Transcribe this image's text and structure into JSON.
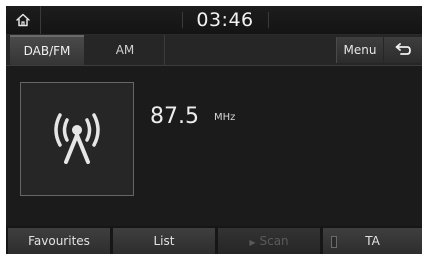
{
  "status_bar": {
    "time": "03:46",
    "home_icon": "home-icon"
  },
  "tabs": [
    {
      "label": "DAB/FM",
      "active": true
    },
    {
      "label": "AM",
      "active": false
    }
  ],
  "header_buttons": {
    "menu_label": "Menu",
    "back_icon": "back-arrow-icon"
  },
  "station": {
    "icon": "radio-tower-icon",
    "frequency": "87.5",
    "unit": "MHz"
  },
  "softkeys": [
    {
      "label": "Favourites",
      "enabled": true
    },
    {
      "label": "List",
      "enabled": true
    },
    {
      "label": "Scan",
      "enabled": false
    },
    {
      "label": "TA",
      "enabled": true
    }
  ],
  "colors": {
    "background": "#161616",
    "text": "#ededed",
    "button": "#3a3a3a"
  }
}
